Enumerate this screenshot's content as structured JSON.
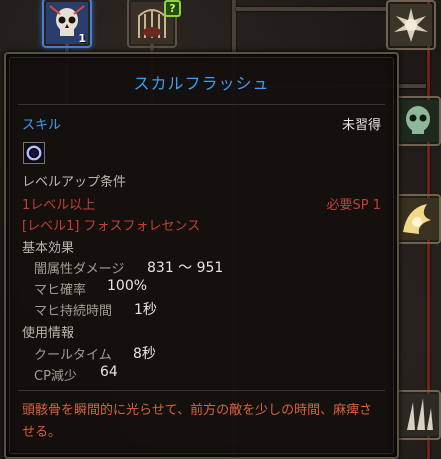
{
  "tree": {
    "skill_icons": [
      {
        "name": "skull-flash-skill-icon",
        "level": "1",
        "active": true
      },
      {
        "name": "bone-cage-skill-icon",
        "badge": "?"
      },
      {
        "name": "skull-burst-skill-icon"
      },
      {
        "name": "green-skull-skill-icon"
      },
      {
        "name": "spirit-wing-skill-icon"
      },
      {
        "name": "bone-spikes-skill-icon"
      }
    ]
  },
  "tooltip": {
    "title": "スカルフラッシュ",
    "skill_label": "スキル",
    "learn_status": "未習得",
    "levelup_heading": "レベルアップ条件",
    "req_level": "1レベル以上",
    "req_sp": "必要SP 1",
    "req_prereq": "[レベル1] フォスフォレセンス",
    "basic_heading": "基本効果",
    "effects": [
      {
        "label": "闇属性ダメージ",
        "value": "831 ～ 951"
      },
      {
        "label": "マヒ確率",
        "value": "100%"
      },
      {
        "label": "マヒ持続時間",
        "value": "1秒"
      }
    ],
    "usage_heading": "使用情報",
    "usage": [
      {
        "label": "クールタイム",
        "value": "8秒"
      },
      {
        "label": "CP減少",
        "value": "64"
      }
    ],
    "description": "頭骸骨を瞬間的に光らせて、前方の敵を少しの時間、麻痺させる。"
  },
  "colors": {
    "title": "#3f9cf2",
    "requirement": "#c73d33",
    "description": "#d8623e",
    "badge": "#8fd43a"
  }
}
